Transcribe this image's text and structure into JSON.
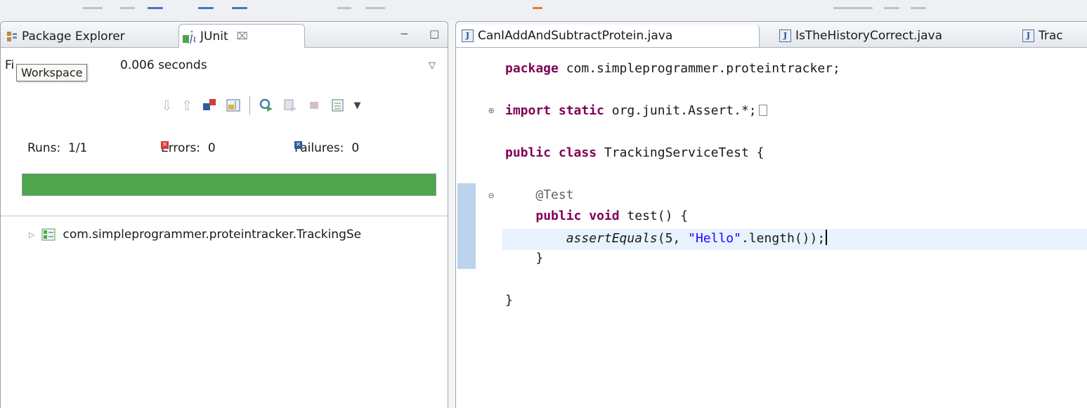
{
  "left_panel": {
    "tabs": [
      {
        "label": "Package Explorer",
        "icon": "package-explorer-icon"
      },
      {
        "label": "JUnit",
        "icon": "junit-icon",
        "close": "⌧"
      }
    ],
    "window_controls": {
      "minimize": "−",
      "maximize": "□"
    },
    "finished_prefix": "Fi",
    "finished_time": "0.006 seconds",
    "tooltip": "Workspace",
    "counters": {
      "runs_label": "Runs:",
      "runs_value": "1/1",
      "errors_label": "Errors:",
      "errors_value": "0",
      "failures_label": "Failures:",
      "failures_value": "0"
    },
    "progress": {
      "fraction": 1.0,
      "color": "#4ea54e"
    },
    "tree": [
      {
        "label": "com.simpleprogrammer.proteintracker.TrackingSe",
        "icon": "test-class-icon"
      }
    ]
  },
  "editor": {
    "tabs": [
      {
        "label": "CanIAddAndSubtractProtein.java",
        "active": true
      },
      {
        "label": "IsTheHistoryCorrect.java",
        "active": false
      },
      {
        "label": "Trac",
        "active": false
      }
    ],
    "code": {
      "package_kw": "package",
      "package_name": " com.simpleprogrammer.proteintracker;",
      "import_kw": "import",
      "static_kw": " static",
      "import_rest": " org.junit.Assert.*;",
      "public_kw": "public",
      "class_kw": " class",
      "class_rest": " TrackingServiceTest {",
      "annotation": "@Test",
      "void_kw": " void",
      "method_rest": " test() {",
      "assert_call": "assertEquals",
      "assert_args_pre": "(5, ",
      "assert_string": "\"Hello\"",
      "assert_args_post": ".length());",
      "close_method": "}",
      "close_class": "}"
    }
  },
  "colors": {
    "keyword": "#7f0055",
    "string": "#2a00ff",
    "annotation": "#646464",
    "error": "#d73a3a",
    "failure": "#2e5c9e"
  }
}
